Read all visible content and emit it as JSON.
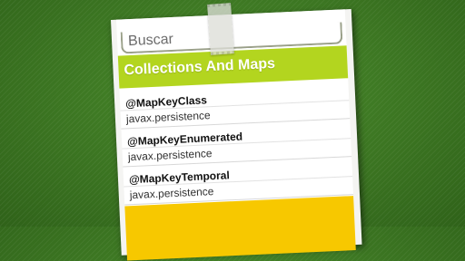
{
  "search": {
    "placeholder": "Buscar"
  },
  "section": {
    "title": "Collections And Maps"
  },
  "items": [
    {
      "title": "@MapKeyClass",
      "package": "javax.persistence"
    },
    {
      "title": "@MapKeyEnumerated",
      "package": "javax.persistence"
    },
    {
      "title": "@MapKeyTemporal",
      "package": "javax.persistence"
    }
  ],
  "colors": {
    "background": "#3e7a25",
    "header": "#b3d51f",
    "footer": "#f7c800"
  }
}
